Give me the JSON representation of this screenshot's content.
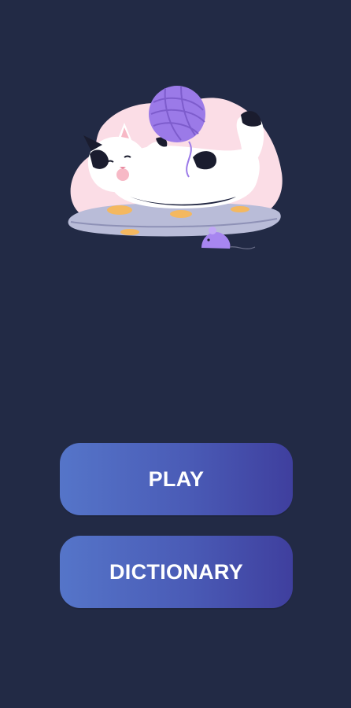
{
  "app": {
    "background_color": "#222a45"
  },
  "hero": {
    "illustration": "cat-with-yarn-ball-on-cushion",
    "colors": {
      "blob": "#fbdde6",
      "yarn": "#9b7ae8",
      "cushion": "#b9bcd8",
      "cushion_spots": "#f4b860",
      "mouse": "#a786f0"
    }
  },
  "menu": {
    "play_label": "PLAY",
    "dictionary_label": "DICTIONARY",
    "button_gradient": [
      "#5575c9",
      "#3f3f9e"
    ],
    "text_color": "#ffffff"
  }
}
